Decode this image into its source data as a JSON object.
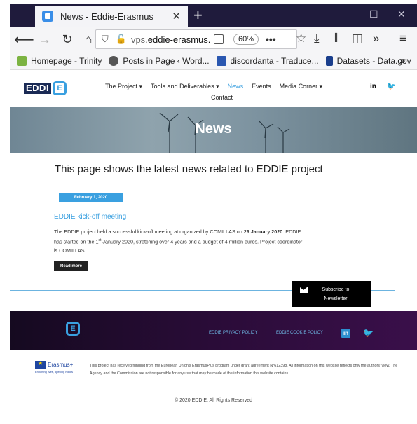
{
  "browser": {
    "tab_title": "News - Eddie-Erasmus",
    "tab_close": "✕",
    "new_tab": "+",
    "window_controls": [
      "—",
      "☐",
      "✕"
    ],
    "url_prefix": "vps.",
    "url_domain": "eddie-erasmus.",
    "zoom": "60%",
    "more": "•••",
    "bookmarks": [
      {
        "label": "Homepage - Trinity",
        "icon": "trinity-icon",
        "color": "#7cb342"
      },
      {
        "label": "Posts in Page ‹ Word...",
        "icon": "wordpress-icon",
        "color": "#555555"
      },
      {
        "label": "discordanta - Traduce...",
        "icon": "dictionary-icon",
        "color": "#2a57b0"
      },
      {
        "label": "Datasets - Data.gov",
        "icon": "datagov-icon",
        "color": "#1a3e8c"
      }
    ]
  },
  "site": {
    "logo_text": "EDDI",
    "logo_e": "E",
    "menu": {
      "project": "The Project ▾",
      "tools": "Tools and Deliverables ▾",
      "news": "News",
      "events": "Events",
      "media": "Media Corner ▾",
      "contact": "Contact"
    },
    "hero_title": "News",
    "intro": "This page shows the latest news related to EDDIE project",
    "post": {
      "date": "February 1, 2020",
      "title": "EDDIE kick-off meeting",
      "body_1": "The EDDIE project held a successful kick-off meeting at organized by COMILLAS on ",
      "body_bold_1": "29 January",
      "body_bold_2": "2020",
      "body_2": ". EDDIE has started on the 1",
      "body_sup": "st",
      "body_3": " January 2020, stretching over 4 years and a budget of 4 million euros. Project coordinator is COMILLAS",
      "read_more": "Read more"
    },
    "subscribe": "Subscribe to Newsletter",
    "footer": {
      "privacy": "EDDIE PRIVACY POLICY",
      "cookie": "EDDIE COOKIE POLICY",
      "linkedin": "in",
      "twitter": "🐦"
    },
    "eu": {
      "name": "Erasmus+",
      "tagline": "Enriching lives, opening minds"
    },
    "funding_text": "This project has received funding from the European Union's ErasmusPlus program under grant agreement N°612398. All information on this website reflects only the authors' view. The Agency and the Commission are not responsible for any use that may be made of the information this website contains.",
    "copyright": "© 2020 EDDIE. All Rights Reserved"
  },
  "colors": {
    "accent": "#3aa0e0",
    "tabbar": "#1f1b3c",
    "footer": "#2a0c38"
  }
}
